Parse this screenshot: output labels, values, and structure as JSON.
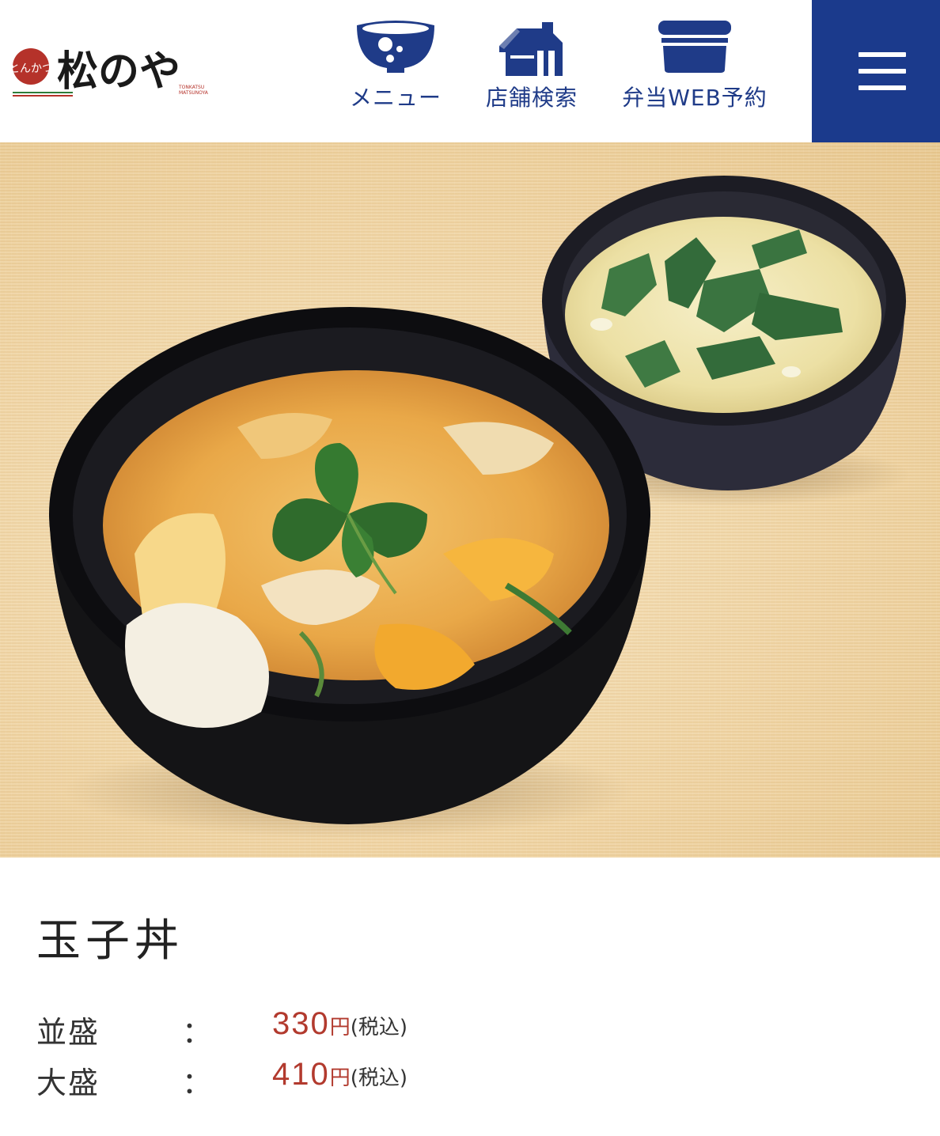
{
  "header": {
    "brand_mark": "とんかつ",
    "brand_name": "松のや",
    "brand_roman_1": "TONKATSU",
    "brand_roman_2": "MATSUNOYA",
    "nav": [
      {
        "label": "メニュー",
        "icon": "bowl-icon"
      },
      {
        "label": "店舗検索",
        "icon": "store-icon"
      },
      {
        "label": "弁当WEB予約",
        "icon": "bento-box-icon"
      }
    ],
    "menu_icon": "hamburger-menu-icon"
  },
  "colors": {
    "brand_blue": "#1b3a8c",
    "price_red": "#b23a2e",
    "logo_red": "#b5322a"
  },
  "product": {
    "name": "玉子丼",
    "image": "tamago-don-with-miso-soup",
    "prices": [
      {
        "size": "並盛",
        "separator": "：",
        "amount": "330",
        "yen": "円",
        "tax": "(税込)"
      },
      {
        "size": "大盛",
        "separator": "：",
        "amount": "410",
        "yen": "円",
        "tax": "(税込)"
      }
    ]
  }
}
